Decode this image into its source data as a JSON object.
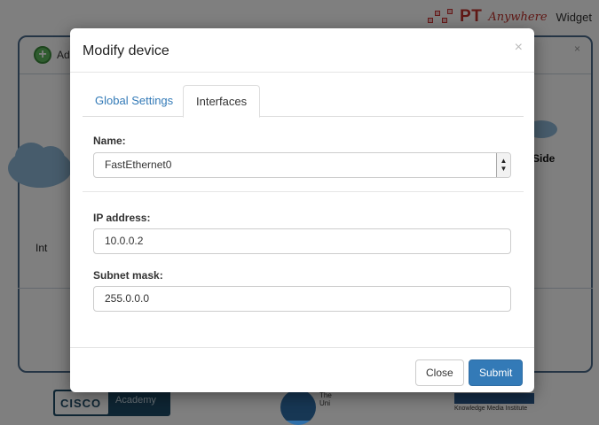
{
  "app": {
    "brand_pt": "PT",
    "brand_anywhere": "Anywhere",
    "brand_widget": "Widget",
    "add_label": "Ad",
    "bg_close": "×",
    "cloud_label": "Int",
    "side_label": "Side",
    "footer": {
      "cisco": "CISCO",
      "academy": "Academy",
      "ou": "The Uni",
      "kmi": "Knowledge Media Institute"
    }
  },
  "modal": {
    "title": "Modify device",
    "close_symbol": "×",
    "tabs": [
      {
        "label": "Global Settings",
        "active": false
      },
      {
        "label": "Interfaces",
        "active": true
      }
    ],
    "name_label": "Name:",
    "name_selected": "FastEthernet0",
    "ip_label": "IP address:",
    "ip_value": "10.0.0.2",
    "mask_label": "Subnet mask:",
    "mask_value": "255.0.0.0",
    "buttons": {
      "close": "Close",
      "submit": "Submit"
    }
  },
  "colors": {
    "primary": "#337ab7",
    "brand_red": "#c0302b",
    "panel_border": "#4a6a8a"
  }
}
